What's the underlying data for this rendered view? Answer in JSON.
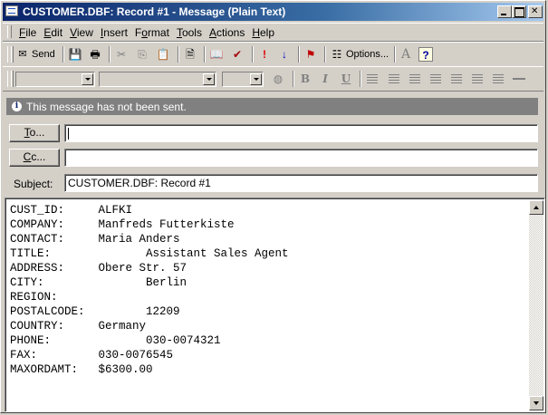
{
  "window": {
    "title": "CUSTOMER.DBF: Record #1 - Message (Plain Text)"
  },
  "menu": [
    {
      "label": "File",
      "mnemonic": "F"
    },
    {
      "label": "Edit",
      "mnemonic": "E"
    },
    {
      "label": "View",
      "mnemonic": "V"
    },
    {
      "label": "Insert",
      "mnemonic": "I"
    },
    {
      "label": "Format",
      "mnemonic": "o"
    },
    {
      "label": "Tools",
      "mnemonic": "T"
    },
    {
      "label": "Actions",
      "mnemonic": "A"
    },
    {
      "label": "Help",
      "mnemonic": "H"
    }
  ],
  "toolbar": {
    "send_label": "Send",
    "options_label": "Options...",
    "icons": [
      "send-icon",
      "save-icon",
      "print-icon",
      "cut-icon",
      "copy-icon",
      "paste-icon",
      "attach-file-icon",
      "address-book-icon",
      "check-names-icon",
      "importance-high-icon",
      "importance-low-icon",
      "flag-icon",
      "options-icon",
      "font-icon",
      "help-icon"
    ]
  },
  "format_bar": {
    "font_name": "",
    "font_style": "",
    "font_size": ""
  },
  "infobar": {
    "message": "This message has not been sent."
  },
  "to": {
    "button_label": "To...",
    "value": ""
  },
  "cc": {
    "button_label": "Cc...",
    "value": ""
  },
  "subject": {
    "label": "Subject:",
    "value": "CUSTOMER.DBF: Record #1"
  },
  "body": {
    "lines": [
      "CUST_ID:     ALFKI",
      "COMPANY:     Manfreds Futterkiste",
      "CONTACT:     Maria Anders",
      "TITLE:              Assistant Sales Agent",
      "ADDRESS:     Obere Str. 57",
      "CITY:               Berlin",
      "REGION:",
      "POSTALCODE:         12209",
      "COUNTRY:     Germany",
      "PHONE:              030-0074321",
      "FAX:         030-0076545",
      "MAXORDAMT:   $6300.00"
    ]
  },
  "colors": {
    "titlebar_start": "#0a246a",
    "titlebar_end": "#a6caf0",
    "face": "#d4d0c8",
    "infobar": "#808080"
  }
}
